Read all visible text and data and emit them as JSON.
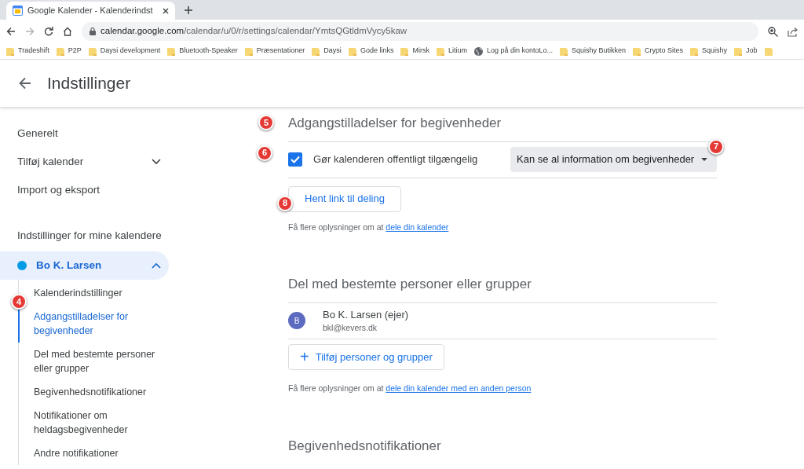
{
  "browser": {
    "tab": {
      "title": "Google Kalender - Kalenderindst",
      "selected": true
    },
    "url_host": "calendar.google.com",
    "url_path": "/calendar/u/0/r/settings/calendar/YmtsQGtldmVycy5kaw",
    "bookmarks": [
      {
        "label": "Tradeshift",
        "kind": "folder"
      },
      {
        "label": "P2P",
        "kind": "folder"
      },
      {
        "label": "Daysi development",
        "kind": "folder"
      },
      {
        "label": "Bluetooth-Speaker",
        "kind": "folder"
      },
      {
        "label": "Præsentationer",
        "kind": "folder"
      },
      {
        "label": "Daysi",
        "kind": "folder"
      },
      {
        "label": "Gode links",
        "kind": "folder"
      },
      {
        "label": "Mirsk",
        "kind": "folder"
      },
      {
        "label": "Litium",
        "kind": "folder"
      },
      {
        "label": "Log på din kontoLo...",
        "kind": "globe"
      },
      {
        "label": "Squishy Butikken",
        "kind": "folder"
      },
      {
        "label": "Crypto Sites",
        "kind": "folder"
      },
      {
        "label": "Squishy",
        "kind": "folder"
      },
      {
        "label": "Job",
        "kind": "folder"
      }
    ]
  },
  "header": {
    "title": "Indstillinger"
  },
  "sidebar": {
    "items": [
      {
        "label": "Generelt",
        "kind": "link"
      },
      {
        "label": "Tilføj kalender",
        "kind": "expandable",
        "expanded": false
      },
      {
        "label": "Import og eksport",
        "kind": "link"
      }
    ],
    "section_heading": "Indstillinger for mine kalendere",
    "calendars": [
      {
        "name": "Bo K. Larsen",
        "color": "#039be5",
        "selected": true,
        "expanded": true,
        "children": [
          {
            "label": "Kalenderindstillinger",
            "selected": false
          },
          {
            "label": "Adgangstilladelser for begivenheder",
            "selected": true,
            "annotation": "4"
          },
          {
            "label": "Del med bestemte personer eller grupper",
            "selected": false
          },
          {
            "label": "Begivenhedsnotifikationer",
            "selected": false
          },
          {
            "label": "Notifikationer om heldagsbegivenheder",
            "selected": false
          },
          {
            "label": "Andre notifikationer",
            "selected": false
          }
        ]
      }
    ]
  },
  "access": {
    "title": "Adgangstilladelser for begivenheder",
    "title_annotation": "5",
    "public": {
      "label": "Gør kalenderen offentligt tilgængelig",
      "checked": true,
      "annotation": "6"
    },
    "dropdown": {
      "value": "Kan se al information om begivenheder",
      "annotation": "7"
    },
    "button": {
      "label": "Hent link til deling",
      "annotation": "8"
    },
    "help": {
      "text": "Få flere oplysninger om at",
      "link": "dele din kalender"
    }
  },
  "share": {
    "title": "Del med bestemte personer eller grupper",
    "people": [
      {
        "initial": "B",
        "name": "Bo K. Larsen (ejer)",
        "email": "bkl@kevers.dk"
      }
    ],
    "add_button": {
      "icon": "+",
      "label": "Tilføj personer og grupper"
    },
    "help": {
      "text": "Få flere oplysninger om at",
      "link": "dele din kalender med en anden person"
    }
  },
  "notifications": {
    "title": "Begivenhedsnotifikationer"
  }
}
